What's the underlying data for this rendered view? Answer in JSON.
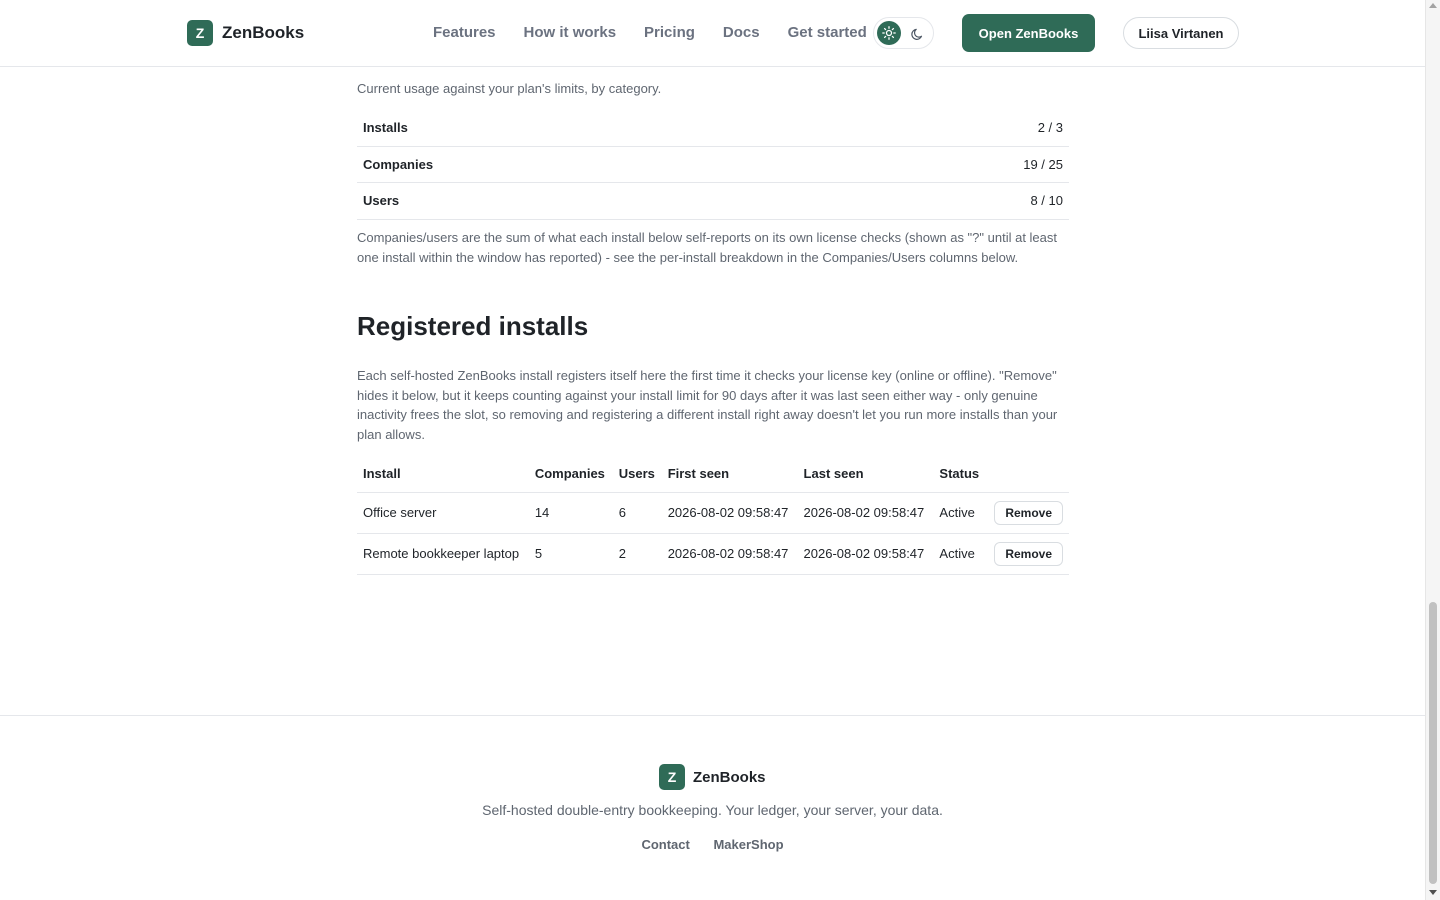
{
  "header": {
    "brand": {
      "logo_letter": "Z",
      "name": "ZenBooks"
    },
    "nav": [
      "Features",
      "How it works",
      "Pricing",
      "Docs",
      "Get started"
    ],
    "theme_toggle": {
      "light_icon": "sun-icon",
      "dark_icon": "moon-icon",
      "selected": "light"
    },
    "open_button": "Open ZenBooks",
    "user_button": "Liisa Virtanen"
  },
  "usage": {
    "description": "Current usage against your plan's limits, by category.",
    "rows": [
      {
        "label": "Installs",
        "value": "2 / 3"
      },
      {
        "label": "Companies",
        "value": "19 / 25"
      },
      {
        "label": "Users",
        "value": "8 / 10"
      }
    ],
    "note": "Companies/users are the sum of what each install below self-reports on its own license checks (shown as \"?\" until at least one install within the window has reported) - see the per-install breakdown in the Companies/Users columns below."
  },
  "installs_section": {
    "title": "Registered installs",
    "description": "Each self-hosted ZenBooks install registers itself here the first time it checks your license key (online or offline). \"Remove\" hides it below, but it keeps counting against your install limit for 90 days after it was last seen either way - only genuine inactivity frees the slot, so removing and registering a different install right away doesn't let you run more installs than your plan allows.",
    "columns": [
      "Install",
      "Companies",
      "Users",
      "First seen",
      "Last seen",
      "Status"
    ],
    "rows": [
      {
        "install": "Office server",
        "companies": "14",
        "users": "6",
        "first_seen": "2026-08-02 09:58:47",
        "last_seen": "2026-08-02 09:58:47",
        "status": "Active",
        "action": "Remove"
      },
      {
        "install": "Remote bookkeeper laptop",
        "companies": "5",
        "users": "2",
        "first_seen": "2026-08-02 09:58:47",
        "last_seen": "2026-08-02 09:58:47",
        "status": "Active",
        "action": "Remove"
      }
    ]
  },
  "footer": {
    "brand": {
      "logo_letter": "Z",
      "name": "ZenBooks"
    },
    "tagline": "Self-hosted double-entry bookkeeping. Your ledger, your server, your data.",
    "links": [
      "Contact",
      "MakerShop"
    ]
  },
  "colors": {
    "accent": "#2f6b57",
    "border": "#e5e7eb",
    "muted_text": "#5f6670"
  }
}
